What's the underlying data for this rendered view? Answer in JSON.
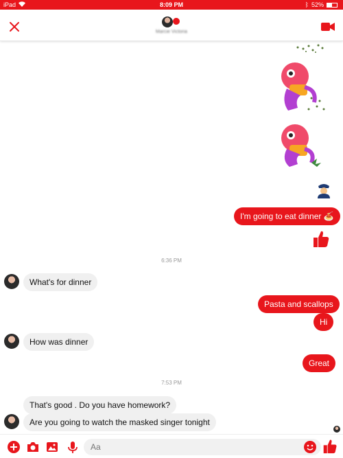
{
  "status": {
    "carrier": "iPad",
    "time": "8:09 PM",
    "battery": "52%",
    "battery_level": 0.52
  },
  "header": {
    "contact_name": "Marcie Victoria"
  },
  "messages": {
    "ts1": "6:36 PM",
    "ts2": "7:53 PM",
    "out1": "I'm going to eat dinner 🍝",
    "in1": "What's for dinner",
    "out2": "Pasta and scallops",
    "out3": "Hi",
    "in2": "How was dinner",
    "out4": "Great",
    "in3": "That's good .  Do you have homework?",
    "in4": "Are you going to watch the masked singer tonight"
  },
  "composer": {
    "placeholder": "Aa"
  },
  "colors": {
    "accent": "#e8161c",
    "incoming_bubble": "#f0f0f0"
  },
  "icons": [
    "close-icon",
    "video-call-icon",
    "plus-icon",
    "camera-icon",
    "gallery-icon",
    "microphone-icon",
    "emoji-icon",
    "thumbs-up-icon",
    "police-officer-emoji",
    "sticker"
  ]
}
